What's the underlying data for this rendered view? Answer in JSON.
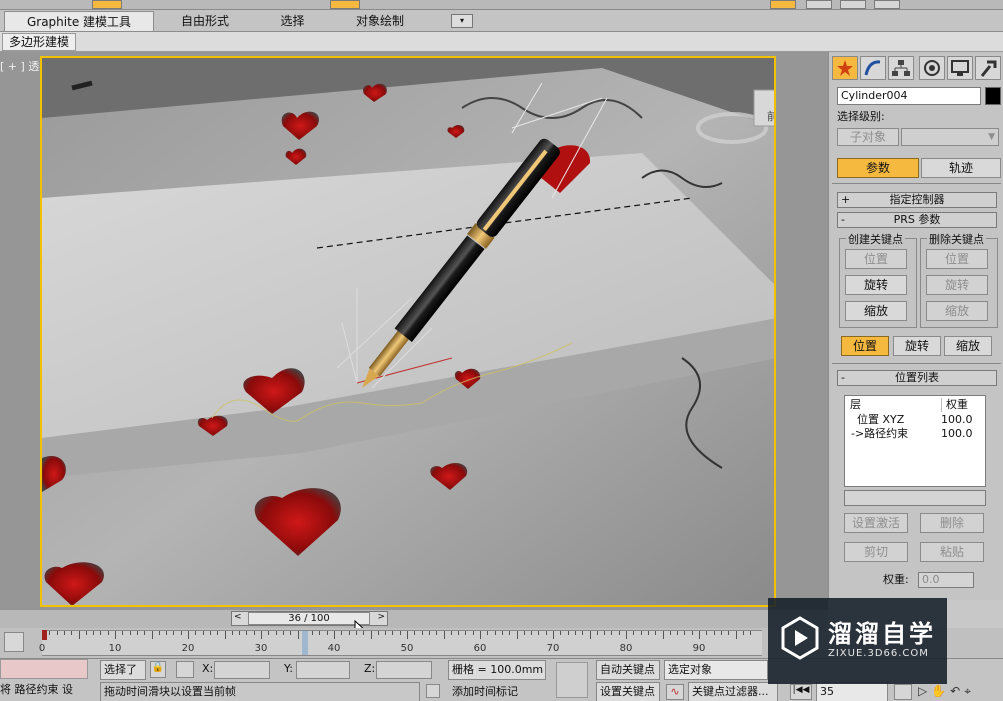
{
  "ribbon": {
    "tabs": [
      {
        "label": "Graphite 建模工具"
      },
      {
        "label": "自由形式"
      },
      {
        "label": "选择"
      },
      {
        "label": "对象绘制"
      }
    ],
    "sub_tab": "多边形建模"
  },
  "viewport": {
    "label": "[ + ] 透视 ] 平滑 + 高光 ]",
    "viewcube_label": "前"
  },
  "command_panel": {
    "object_name": "Cylinder004",
    "selection_level_label": "选择级别:",
    "sub_object_button": "子对象",
    "tab_parameters": "参数",
    "tab_trajectories": "轨迹",
    "rollouts": {
      "assign_controller": "指定控制器",
      "prs_params": "PRS 参数",
      "position_list": "位置列表"
    },
    "create_key_group": "创建关键点",
    "delete_key_group": "删除关键点",
    "create_buttons": [
      "位置",
      "旋转",
      "缩放"
    ],
    "delete_buttons": [
      "位置",
      "旋转",
      "缩放"
    ],
    "mode_buttons": [
      "位置",
      "旋转",
      "缩放"
    ],
    "list_headers": {
      "layer": "层",
      "weight": "权重"
    },
    "list_rows": [
      {
        "name": "位置 XYZ",
        "weight": "100.0"
      },
      {
        "name": "->路径约束",
        "weight": "100.0"
      }
    ],
    "set_active_button": "设置激活",
    "delete_button": "删除",
    "cut_button": "剪切",
    "paste_button": "粘贴",
    "weight_label": "权重:",
    "weight_value": "0.0"
  },
  "timeline": {
    "slider_text": "36 / 100",
    "current_frame": 36,
    "total_frames": 100,
    "ruler_labels": [
      "0",
      "10",
      "20",
      "30",
      "40",
      "50",
      "60",
      "70",
      "80",
      "90"
    ]
  },
  "status_bar": {
    "left_red_text": "",
    "left_bottom_text": "将 路径约束 设",
    "selected_text": "选择了",
    "x_label": "X:",
    "y_label": "Y:",
    "z_label": "Z:",
    "grid_text": "栅格 = 100.0mm",
    "prompt_text": "拖动时间滑块以设置当前帧",
    "add_time_tag": "添加时间标记",
    "auto_key": "自动关键点",
    "selected_object": "选定对象",
    "set_key": "设置关键点",
    "key_filters": "关键点过滤器...",
    "frame_field": "35"
  },
  "watermark": {
    "title": "溜溜自学",
    "url": "ZIXUE.3D66.COM"
  },
  "colors": {
    "accent_yellow": "#f5b940",
    "viewport_border": "#f2c200"
  }
}
